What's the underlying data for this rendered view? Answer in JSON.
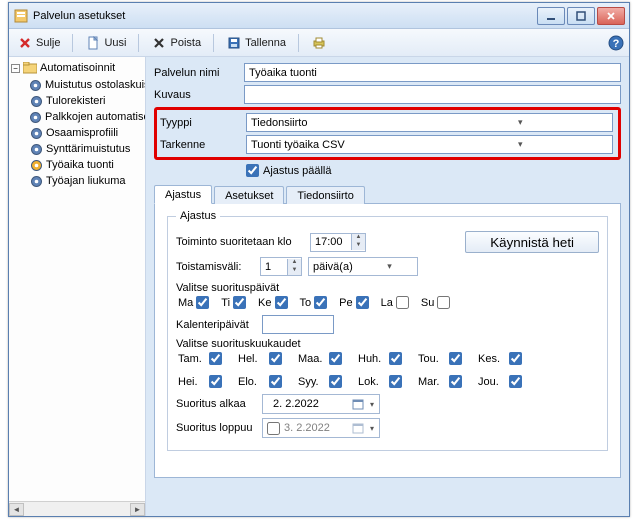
{
  "window": {
    "title": "Palvelun asetukset"
  },
  "toolbar": {
    "close": "Sulje",
    "new": "Uusi",
    "delete": "Poista",
    "save": "Tallenna"
  },
  "sidebar": {
    "root": "Automatisoinnit",
    "items": [
      "Muistutus ostolaskuista",
      "Tulorekisteri",
      "Palkkojen automatisointi",
      "Osaamisprofiili",
      "Synttärimuistutus",
      "Työaika tuonti",
      "Työajan liukuma"
    ]
  },
  "form": {
    "name_label": "Palvelun nimi",
    "name_value": "Työaika tuonti",
    "desc_label": "Kuvaus",
    "desc_value": "",
    "type_label": "Tyyppi",
    "type_value": "Tiedonsiirto",
    "spec_label": "Tarkenne",
    "spec_value": "Tuonti työaika CSV",
    "sched_on_label": "Ajastus päällä",
    "sched_on": true
  },
  "tabs": {
    "t1": "Ajastus",
    "t2": "Asetukset",
    "t3": "Tiedonsiirto"
  },
  "schedule": {
    "legend": "Ajastus",
    "run_at_label": "Toiminto suoritetaan klo",
    "run_at_value": "17:00",
    "run_now_btn": "Käynnistä heti",
    "interval_label": "Toistamisväli:",
    "interval_value": "1",
    "interval_unit": "päivä(a)",
    "days_label": "Valitse suorituspäivät",
    "days": [
      {
        "lbl": "Ma",
        "ck": true
      },
      {
        "lbl": "Ti",
        "ck": true
      },
      {
        "lbl": "Ke",
        "ck": true
      },
      {
        "lbl": "To",
        "ck": true
      },
      {
        "lbl": "Pe",
        "ck": true
      },
      {
        "lbl": "La",
        "ck": false
      },
      {
        "lbl": "Su",
        "ck": false
      }
    ],
    "caldays_label": "Kalenteripäivät",
    "caldays_value": "",
    "months_label": "Valitse suorituskuukaudet",
    "months": [
      {
        "lbl": "Tam.",
        "ck": true
      },
      {
        "lbl": "Hel.",
        "ck": true
      },
      {
        "lbl": "Maa.",
        "ck": true
      },
      {
        "lbl": "Huh.",
        "ck": true
      },
      {
        "lbl": "Tou.",
        "ck": true
      },
      {
        "lbl": "Kes.",
        "ck": true
      },
      {
        "lbl": "Hei.",
        "ck": true
      },
      {
        "lbl": "Elo.",
        "ck": true
      },
      {
        "lbl": "Syy.",
        "ck": true
      },
      {
        "lbl": "Lok.",
        "ck": true
      },
      {
        "lbl": "Mar.",
        "ck": true
      },
      {
        "lbl": "Jou.",
        "ck": true
      }
    ],
    "start_label": "Suoritus alkaa",
    "start_value": "2.  2.2022",
    "end_label": "Suoritus loppuu",
    "end_value": "3.  2.2022",
    "end_enabled": false
  }
}
